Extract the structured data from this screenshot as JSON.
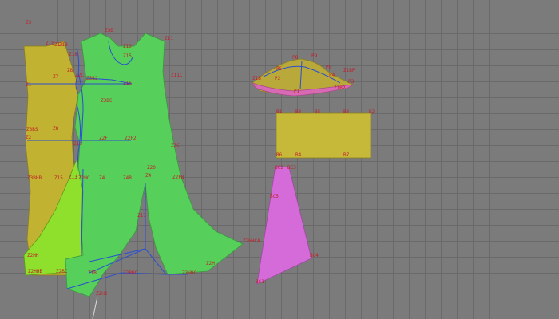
{
  "colors": {
    "background": "#7b7b7b",
    "grid": "#6a6a6a",
    "back_panel": "#c2b232",
    "front_panel": "#56d05a",
    "side_panel": "#8fe02c",
    "sleeve_cap": "#b9a93a",
    "band": "#c6b93a",
    "gusset": "#d56ad9",
    "point_label": "#c0202a",
    "seam": "#2b4fd1"
  },
  "labels": {
    "back": [
      "Z3",
      "Z1",
      "Z10",
      "Z12",
      "Z13",
      "Z3BS",
      "Z3BHB",
      "Z8",
      "Z2",
      "Z2HH",
      "Z2HHB",
      "Z15"
    ],
    "front": [
      "Z3B",
      "Z11",
      "Z11C",
      "Z18",
      "Z7",
      "Z8",
      "Z2C",
      "Z19",
      "Z15",
      "Z3B2",
      "Z16",
      "Z3BC",
      "Z2F",
      "Z2F2",
      "Z4",
      "Z4B",
      "Z2HC",
      "Z1C",
      "Z13",
      "Z2FB",
      "Z2HHCA",
      "Z2H",
      "Z2BHC",
      "Z3HHC",
      "Z2BC",
      "Z1B",
      "Z17",
      "Z20",
      "Z4",
      "Z3C",
      "Z2H2"
    ],
    "sleeve": [
      "Z1B",
      "P2",
      "P5",
      "P8",
      "P9",
      "P4",
      "P3",
      "P1",
      "P8",
      "Z1BP",
      "Z1B2"
    ],
    "band": [
      "B1",
      "B3",
      "B5",
      "B3",
      "B2",
      "B6",
      "B4",
      "B7"
    ],
    "gusset": [
      "BC2",
      "BC3",
      "BC5",
      "BC1",
      "BC4"
    ]
  }
}
